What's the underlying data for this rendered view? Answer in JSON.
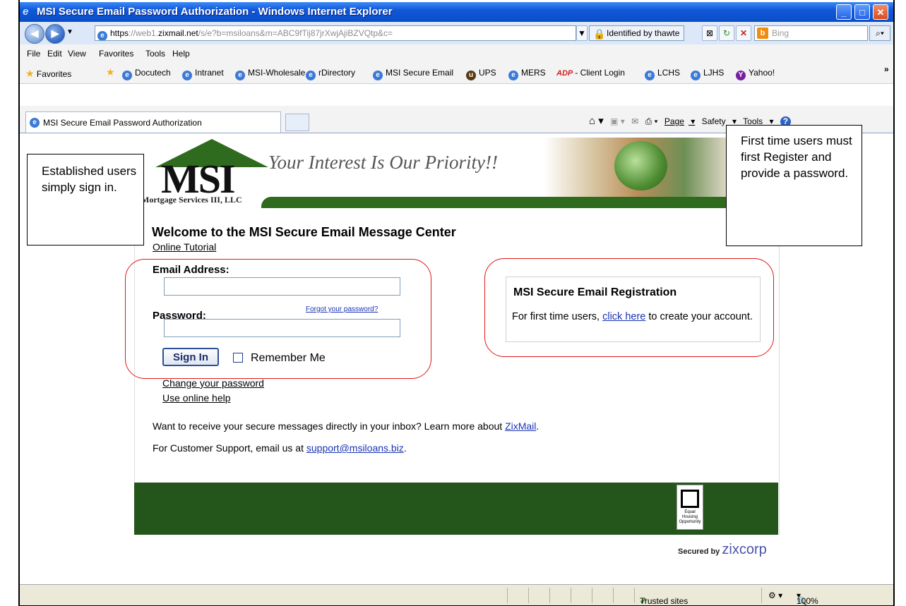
{
  "window": {
    "title": "MSI Secure Email Password Authorization - Windows Internet Explorer"
  },
  "address_bar": {
    "url_scheme": "https",
    "url_host": "://web1.zixmail.net",
    "url_rest": "/s/e?b=msiloans&m=ABC9fTij87jrXwjAjiBZVQtp&c=",
    "certificate": "Identified by thawte",
    "search_placeholder": "Bing"
  },
  "menu": [
    "File",
    "Edit",
    "View",
    "Favorites",
    "Tools",
    "Help"
  ],
  "favorites": {
    "label": "Favorites",
    "items": [
      "Docutech",
      "Intranet",
      "MSI-Wholesale",
      "rDirectory",
      "MSI Secure Email",
      "UPS",
      "MERS",
      "- Client Login",
      "LCHS",
      "LJHS",
      "Yahoo!"
    ]
  },
  "tab": {
    "active_label": "MSI Secure Email Password Authorization"
  },
  "command_bar": {
    "page": "Page",
    "safety": "Safety",
    "tools": "Tools"
  },
  "banner": {
    "logo_text": "MSI",
    "tagline": "Your Interest Is Our Priority!!",
    "company": "Mortgage Services III, LLC"
  },
  "login": {
    "welcome": "Welcome to the MSI Secure Email Message Center",
    "tutorial_link": "Online Tutorial",
    "email_label": "Email Address:",
    "email_value": "",
    "password_label": "Password:",
    "forgot_link": "Forgot your password?",
    "password_value": "",
    "signin_button": "Sign In",
    "remember_label": "Remember Me",
    "change_password_link": "Change your password",
    "help_link": "Use online help"
  },
  "registration": {
    "title": "MSI Secure Email Registration",
    "text_before": "For first time users, ",
    "link": "click here",
    "text_after": " to create your account."
  },
  "info": {
    "zixmail_text": "Want to receive your secure messages directly in your inbox? Learn more about ",
    "zixmail_link": "ZixMail",
    "zixmail_end": ".",
    "support_text": "For Customer Support, email us at ",
    "support_link": "support@msiloans.biz",
    "support_end": "."
  },
  "footer": {
    "eho_text": "Equal Housing Opportunity",
    "secured_by": "Secured by",
    "zix_brand": "zixcorp"
  },
  "callouts": {
    "left": "Established users simply sign in.",
    "right": "First time users must first Register and provide a password."
  },
  "status_bar": {
    "zone": "Trusted sites",
    "zoom": "100%"
  },
  "colors": {
    "titlebar": "#0a4dc7",
    "footer": "#24551a",
    "link": "#1a34b5",
    "annotation_circle": "#e01818"
  }
}
